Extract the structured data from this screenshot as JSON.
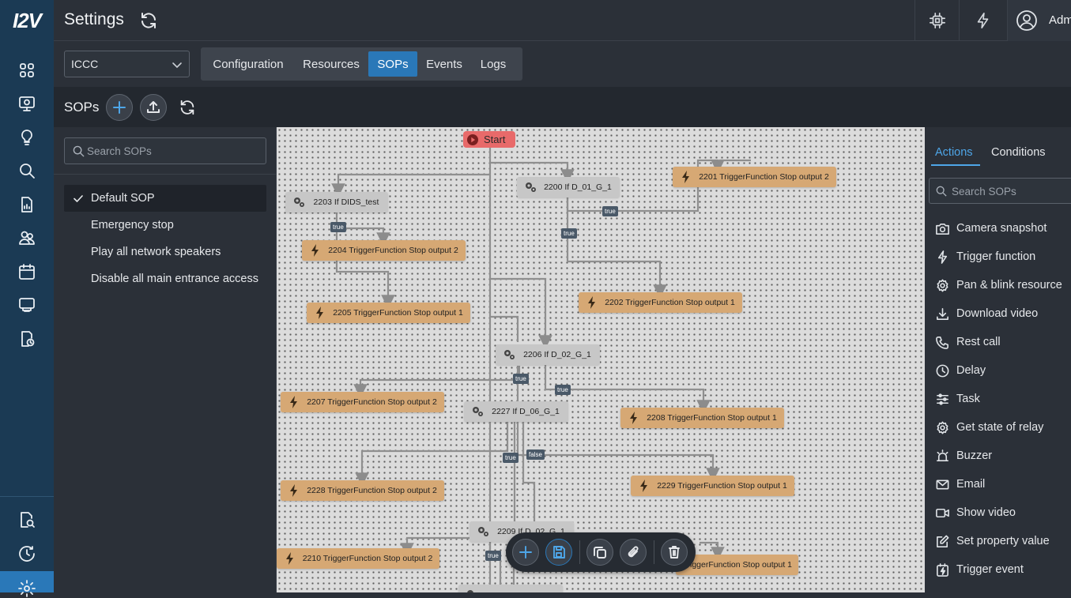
{
  "brand": {
    "logo_text": "I2V"
  },
  "rail": {
    "items": [
      {
        "name": "dashboard-icon"
      },
      {
        "name": "monitor-camera-icon"
      },
      {
        "name": "lightbulb-icon"
      },
      {
        "name": "search-icon"
      },
      {
        "name": "report-icon"
      },
      {
        "name": "users-icon"
      },
      {
        "name": "calendar-icon"
      },
      {
        "name": "display-icon"
      },
      {
        "name": "history-file-icon"
      },
      {
        "name": "search-document-icon"
      },
      {
        "name": "clock-icon"
      },
      {
        "name": "settings-icon"
      }
    ]
  },
  "header": {
    "title": "Settings",
    "user_name": "Adm"
  },
  "settings": {
    "site_select": {
      "value": "ICCC"
    },
    "tabs": [
      {
        "label": "Configuration"
      },
      {
        "label": "Resources"
      },
      {
        "label": "SOPs",
        "active": true
      },
      {
        "label": "Events"
      },
      {
        "label": "Logs"
      }
    ]
  },
  "sops": {
    "title": "SOPs",
    "search_placeholder": "Search SOPs",
    "items": [
      {
        "label": "Default SOP",
        "active": true
      },
      {
        "label": "Emergency stop"
      },
      {
        "label": "Play all network speakers"
      },
      {
        "label": "Disable all main entrance access"
      }
    ]
  },
  "canvas": {
    "start_label": "Start",
    "nodes": [
      {
        "id": "2200",
        "kind": "condition",
        "label": "2200 If D_01_G_1"
      },
      {
        "id": "2201",
        "kind": "action",
        "label": "2201 TriggerFunction Stop output 2"
      },
      {
        "id": "2203",
        "kind": "condition",
        "label": "2203 If DIDS_test"
      },
      {
        "id": "2204",
        "kind": "action",
        "label": "2204 TriggerFunction Stop output 2"
      },
      {
        "id": "2205",
        "kind": "action",
        "label": "2205 TriggerFunction Stop output 1"
      },
      {
        "id": "2202",
        "kind": "action",
        "label": "2202 TriggerFunction Stop output 1"
      },
      {
        "id": "2206",
        "kind": "condition",
        "label": "2206 If D_02_G_1"
      },
      {
        "id": "2207",
        "kind": "action",
        "label": "2207 TriggerFunction Stop output 2"
      },
      {
        "id": "2227",
        "kind": "condition",
        "label": "2227 If D_06_G_1"
      },
      {
        "id": "2208",
        "kind": "action",
        "label": "2208 TriggerFunction Stop output 1"
      },
      {
        "id": "2228",
        "kind": "action",
        "label": "2228 TriggerFunction Stop output 2"
      },
      {
        "id": "2229",
        "kind": "action",
        "label": "2229 TriggerFunction Stop output 1"
      },
      {
        "id": "2209",
        "kind": "condition",
        "label": "2209 If D_02_G_1"
      },
      {
        "id": "2210",
        "kind": "action",
        "label": "2210 TriggerFunction Stop output 2"
      },
      {
        "id": "2211",
        "kind": "action",
        "label": "TriggerFunction Stop output 1"
      }
    ],
    "badges": [
      "true",
      "true",
      "true",
      "true",
      "true",
      "true",
      "false",
      "true"
    ],
    "toolbar": [
      {
        "name": "add-node-button"
      },
      {
        "name": "save-button"
      },
      {
        "name": "copy-button"
      },
      {
        "name": "attach-button"
      },
      {
        "name": "delete-button"
      }
    ]
  },
  "right_panel": {
    "tabs": [
      {
        "label": "Actions",
        "active": true
      },
      {
        "label": "Conditions"
      }
    ],
    "search_placeholder": "Search SOPs",
    "actions": [
      {
        "label": "Camera snapshot",
        "icon": "camera-icon"
      },
      {
        "label": "Trigger function",
        "icon": "lightning-icon"
      },
      {
        "label": "Pan & blink resource",
        "icon": "gear-icon"
      },
      {
        "label": "Download video",
        "icon": "download-icon"
      },
      {
        "label": "Rest call",
        "icon": "phone-icon"
      },
      {
        "label": "Delay",
        "icon": "clock-icon"
      },
      {
        "label": "Task",
        "icon": "sliders-icon"
      },
      {
        "label": "Get state of relay",
        "icon": "gear-icon"
      },
      {
        "label": "Buzzer",
        "icon": "siren-icon"
      },
      {
        "label": "Email",
        "icon": "mail-icon"
      },
      {
        "label": "Show video",
        "icon": "video-icon"
      },
      {
        "label": "Set property value",
        "icon": "edit-icon"
      },
      {
        "label": "Trigger event",
        "icon": "event-icon"
      }
    ]
  },
  "colors": {
    "accent": "#2a78b8",
    "rail_bg": "#1b3a54",
    "condition_node": "#c7c7c7",
    "action_node": "#d6a874",
    "start_node": "#e86a6a",
    "tab_active_text": "#4ea6e8"
  }
}
